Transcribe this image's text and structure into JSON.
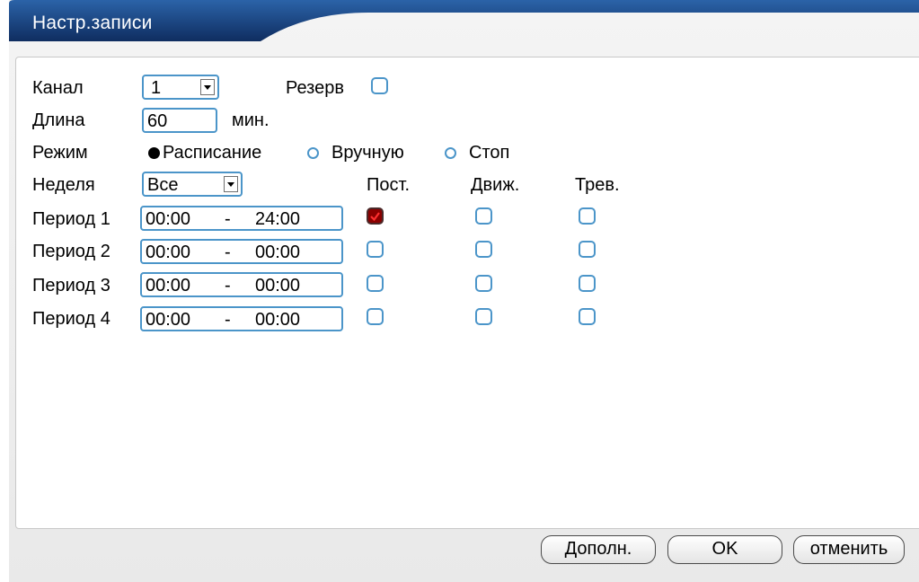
{
  "window": {
    "title": "Настр.записи"
  },
  "channel": {
    "label": "Канал",
    "value": "1"
  },
  "reserve": {
    "label": "Резерв",
    "checked": false
  },
  "length": {
    "label": "Длина",
    "value": "60",
    "unit": "мин."
  },
  "mode": {
    "label": "Режим",
    "options": [
      {
        "label": "Расписание",
        "selected": true
      },
      {
        "label": "Вручную",
        "selected": false
      },
      {
        "label": "Стоп",
        "selected": false
      }
    ]
  },
  "week": {
    "label": "Неделя",
    "value": "Все"
  },
  "columns": {
    "constant": "Пост.",
    "motion": "Движ.",
    "alarm": "Трев."
  },
  "periods": [
    {
      "label": "Период 1",
      "start": "00:00",
      "sep": "-",
      "end": "24:00",
      "constant": true,
      "motion": false,
      "alarm": false
    },
    {
      "label": "Период 2",
      "start": "00:00",
      "sep": "-",
      "end": "00:00",
      "constant": false,
      "motion": false,
      "alarm": false
    },
    {
      "label": "Период 3",
      "start": "00:00",
      "sep": "-",
      "end": "00:00",
      "constant": false,
      "motion": false,
      "alarm": false
    },
    {
      "label": "Период 4",
      "start": "00:00",
      "sep": "-",
      "end": "00:00",
      "constant": false,
      "motion": false,
      "alarm": false
    }
  ],
  "buttons": {
    "advanced": "Дополн.",
    "ok": "OK",
    "cancel": "отменить"
  },
  "colors": {
    "accent": "#4b95c9",
    "title_bar": "#1a3e78",
    "checked": "#8a0000"
  },
  "icons": {
    "dropdown": "chevron-down-icon",
    "checked": "checkmark-icon"
  }
}
